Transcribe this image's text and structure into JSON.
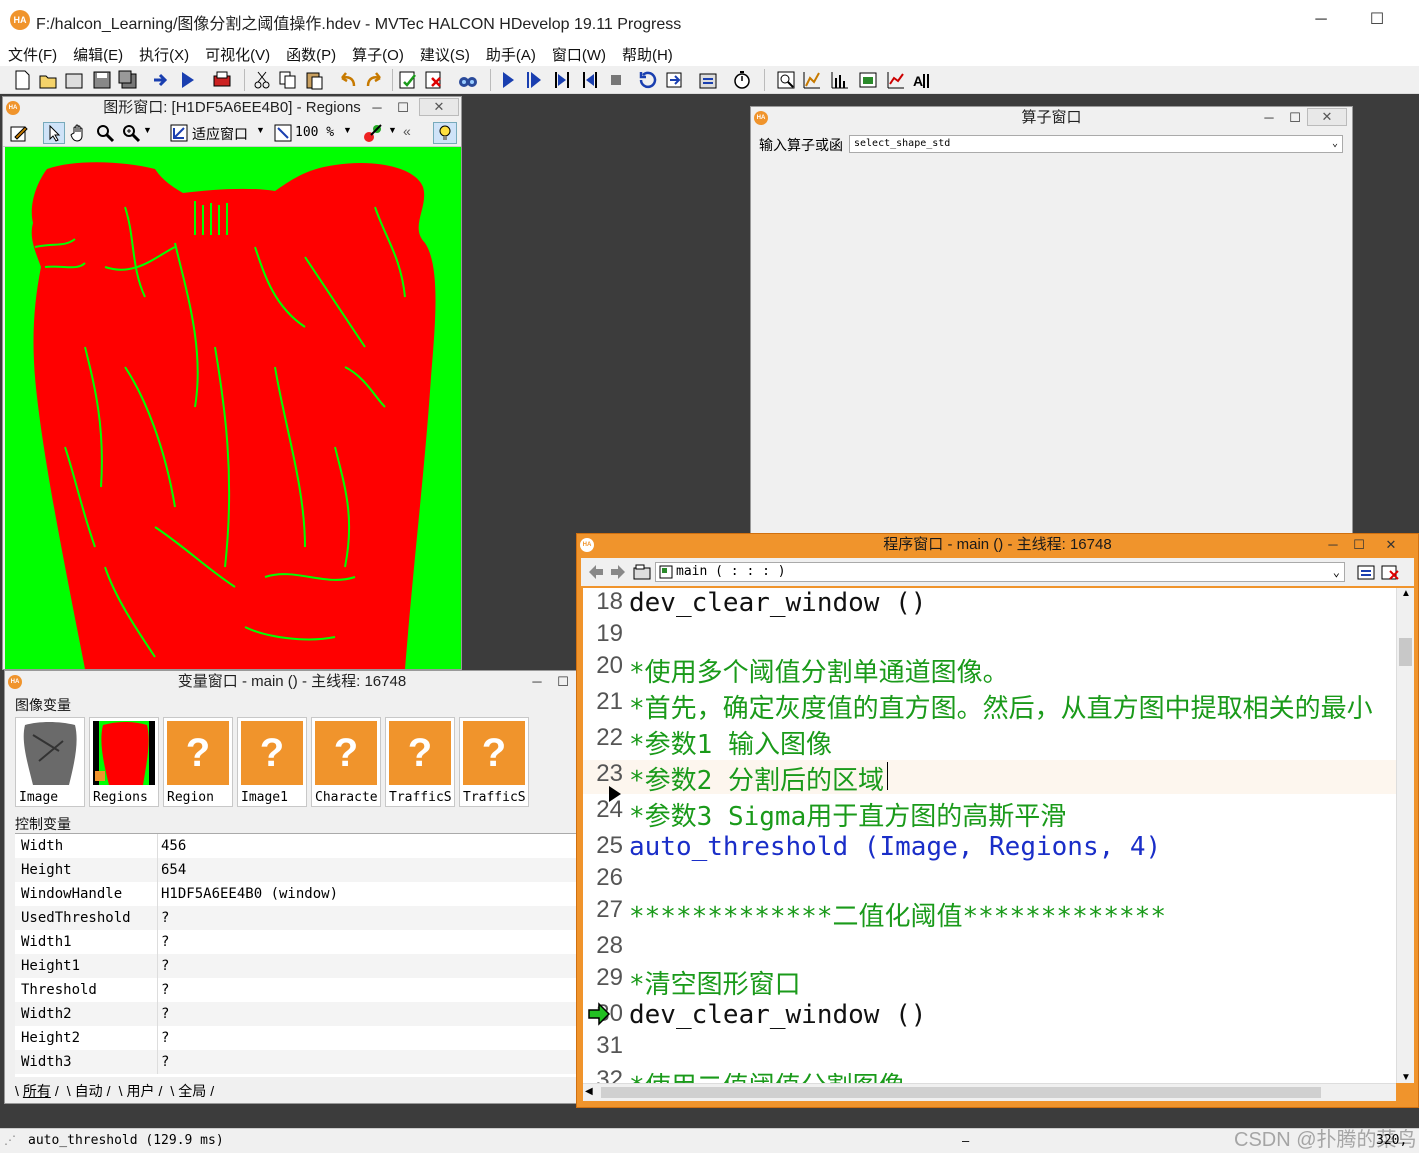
{
  "app": {
    "title": "F:/halcon_Learning/图像分割之阈值操作.hdev - MVTec HALCON HDevelop 19.11 Progress",
    "logo": "HA",
    "minimize": "─",
    "maximize": "☐"
  },
  "menu": [
    "文件(F)",
    "编辑(E)",
    "执行(X)",
    "可视化(V)",
    "函数(P)",
    "算子(O)",
    "建议(S)",
    "助手(A)",
    "窗口(W)",
    "帮助(H)"
  ],
  "graphics_window": {
    "title": "图形窗口: [H1DF5A6EE4B0] - Regions",
    "fit_label": "适应窗口",
    "zoom_value": "100 %",
    "more": "«",
    "colors": {
      "background": "#00ff00",
      "region": "#ff0000"
    }
  },
  "operator_window": {
    "title": "算子窗口",
    "input_label": "输入算子或函",
    "input_value": "select_shape_std"
  },
  "variable_window": {
    "title": "变量窗口 - main () - 主线程: 16748",
    "iconic_section": "图像变量",
    "control_section": "控制变量",
    "iconic": [
      {
        "name": "Image",
        "kind": "image"
      },
      {
        "name": "Regions",
        "kind": "regions"
      },
      {
        "name": "Region",
        "kind": "unknown"
      },
      {
        "name": "Image1",
        "kind": "unknown"
      },
      {
        "name": "Characte",
        "kind": "unknown"
      },
      {
        "name": "TrafficS",
        "kind": "unknown"
      },
      {
        "name": "TrafficS",
        "kind": "unknown"
      }
    ],
    "unknown_symbol": "?",
    "control": [
      {
        "name": "Width",
        "value": "456"
      },
      {
        "name": "Height",
        "value": "654"
      },
      {
        "name": "WindowHandle",
        "value": "H1DF5A6EE4B0 (window)"
      },
      {
        "name": "UsedThreshold",
        "value": "?"
      },
      {
        "name": "Width1",
        "value": "?"
      },
      {
        "name": "Height1",
        "value": "?"
      },
      {
        "name": "Threshold",
        "value": "?"
      },
      {
        "name": "Width2",
        "value": "?"
      },
      {
        "name": "Height2",
        "value": "?"
      },
      {
        "name": "Width3",
        "value": "?"
      }
    ],
    "tabs": [
      "所有",
      "自动",
      "用户",
      "全局"
    ]
  },
  "program_window": {
    "title": "程序窗口 - main () - 主线程: 16748",
    "procedure": "main ( : : : )",
    "lines": [
      {
        "num": "18",
        "text": "dev_clear_window ()",
        "style": "op"
      },
      {
        "num": "19",
        "text": "",
        "style": "op"
      },
      {
        "num": "20",
        "text": "*使用多个阈值分割单通道图像。",
        "style": "cmt"
      },
      {
        "num": "21",
        "text": "*首先，确定灰度值的直方图。然后，从直方图中提取相关的最小",
        "style": "cmt"
      },
      {
        "num": "22",
        "text": "*参数1 输入图像",
        "style": "cmt"
      },
      {
        "num": "23",
        "text": "*参数2 分割后的区域",
        "style": "cmt"
      },
      {
        "num": "24",
        "text": "*参数3 Sigma用于直方图的高斯平滑",
        "style": "cmt"
      },
      {
        "num": "25",
        "text": "auto_threshold (Image, Regions, 4)",
        "style": "kw"
      },
      {
        "num": "26",
        "text": "",
        "style": "op"
      },
      {
        "num": "27",
        "text": "*************二值化阈值*************",
        "style": "cmt"
      },
      {
        "num": "28",
        "text": "",
        "style": "op"
      },
      {
        "num": "29",
        "text": "*清空图形窗口",
        "style": "cmt"
      },
      {
        "num": "30",
        "text": "dev_clear_window ()",
        "style": "op"
      },
      {
        "num": "31",
        "text": "",
        "style": "op"
      },
      {
        "num": "32",
        "text": "*使用二值阈值分割图像",
        "style": "cmt"
      }
    ],
    "highlight_line": "23",
    "pc_line": "30"
  },
  "statusbar": {
    "message": "auto_threshold (129.9 ms)",
    "dash": "–",
    "watermark": "CSDN @扑腾的菜鸟",
    "coords": "320,"
  }
}
